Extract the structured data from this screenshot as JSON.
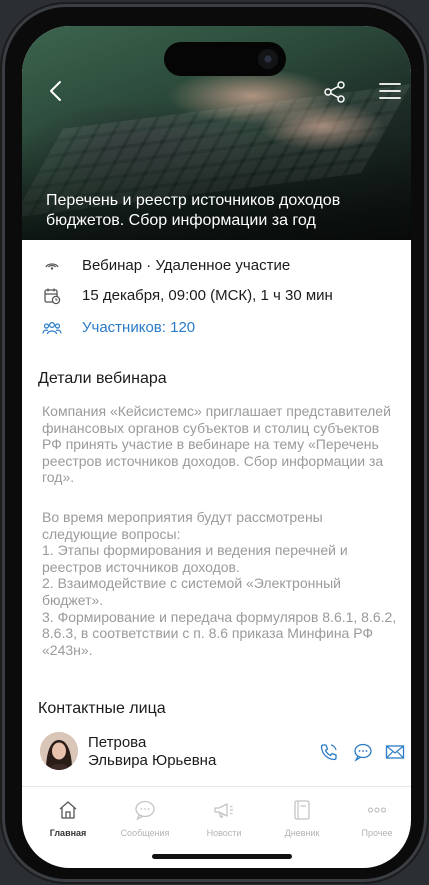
{
  "hero": {
    "title": "Перечень и реестр источников доходов бюджетов. Сбор информации за год"
  },
  "event": {
    "type_label": "Вебинар · Удаленное участие",
    "datetime_label": "15 декабря, 09:00 (МСК),  1 ч 30 мин",
    "participants_label": "Участников: 120"
  },
  "details": {
    "title": "Детали вебинара",
    "paragraph1": "Компания «Кейсистемс» приглашает представителей финансовых органов субъектов и столиц субъектов РФ принять участие в вебинаре на тему «Перечень реестров источников доходов. Сбор информации за год».",
    "paragraph2_lines": [
      "Во время мероприятия будут рассмотрены следующие вопросы:",
      "1. Этапы формирования и ведения перечней и реестров источников доходов.",
      "2. Взаимодействие с системой «Электронный бюджет».",
      "3. Формирование и передача формуляров 8.6.1, 8.6.2, 8.6.3, в соответствии с п. 8.6 приказа Минфина РФ «243н»."
    ]
  },
  "contacts": {
    "title": "Контактные лица",
    "person": {
      "last_name": "Петрова",
      "first_middle": "Эльвира Юрьевна"
    }
  },
  "tabbar": {
    "items": [
      {
        "label": "Главная",
        "icon": "home-icon",
        "active": true
      },
      {
        "label": "Сообщения",
        "icon": "chat-icon",
        "active": false
      },
      {
        "label": "Новости",
        "icon": "megaphone-icon",
        "active": false
      },
      {
        "label": "Дневник",
        "icon": "notebook-icon",
        "active": false
      },
      {
        "label": "Прочее",
        "icon": "more-icon",
        "active": false
      }
    ]
  },
  "colors": {
    "accent": "#2a7bc7",
    "text": "#1b1b1b",
    "muted": "#9a9a9a"
  }
}
